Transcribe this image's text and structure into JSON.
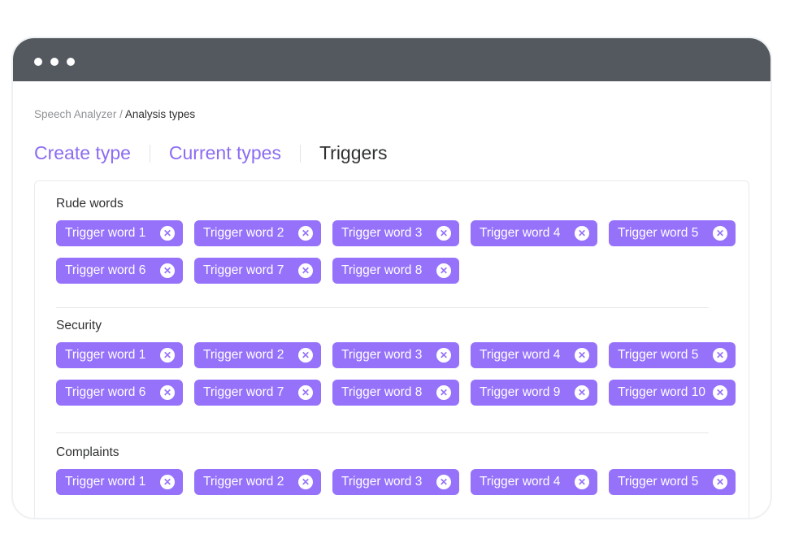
{
  "window": {
    "controls": [
      "dot",
      "dot",
      "dot"
    ]
  },
  "breadcrumb": {
    "parent": "Speech Analyzer",
    "separator": " / ",
    "current": "Analysis types"
  },
  "tabs": [
    {
      "label": "Create type",
      "active": false
    },
    {
      "label": "Current types",
      "active": false
    },
    {
      "label": "Triggers",
      "active": true
    }
  ],
  "colors": {
    "accent": "#9672fb",
    "titlebar": "#545960",
    "tab_link": "#8b6cf2"
  },
  "remove_icon": "close-circle-icon",
  "sections": [
    {
      "title": "Rude words",
      "chips": [
        "Trigger word 1",
        "Trigger word 2",
        "Trigger word 3",
        "Trigger word 4",
        "Trigger word 5",
        "Trigger word 6",
        "Trigger word 7",
        "Trigger word 8"
      ]
    },
    {
      "title": "Security",
      "chips": [
        "Trigger word 1",
        "Trigger word 2",
        "Trigger word 3",
        "Trigger word 4",
        "Trigger word 5",
        "Trigger word 6",
        "Trigger word 7",
        "Trigger word 8",
        "Trigger word 9",
        "Trigger word 10"
      ]
    },
    {
      "title": "Complaints",
      "chips": [
        "Trigger word 1",
        "Trigger word 2",
        "Trigger word 3",
        "Trigger word 4",
        "Trigger word 5"
      ]
    }
  ]
}
